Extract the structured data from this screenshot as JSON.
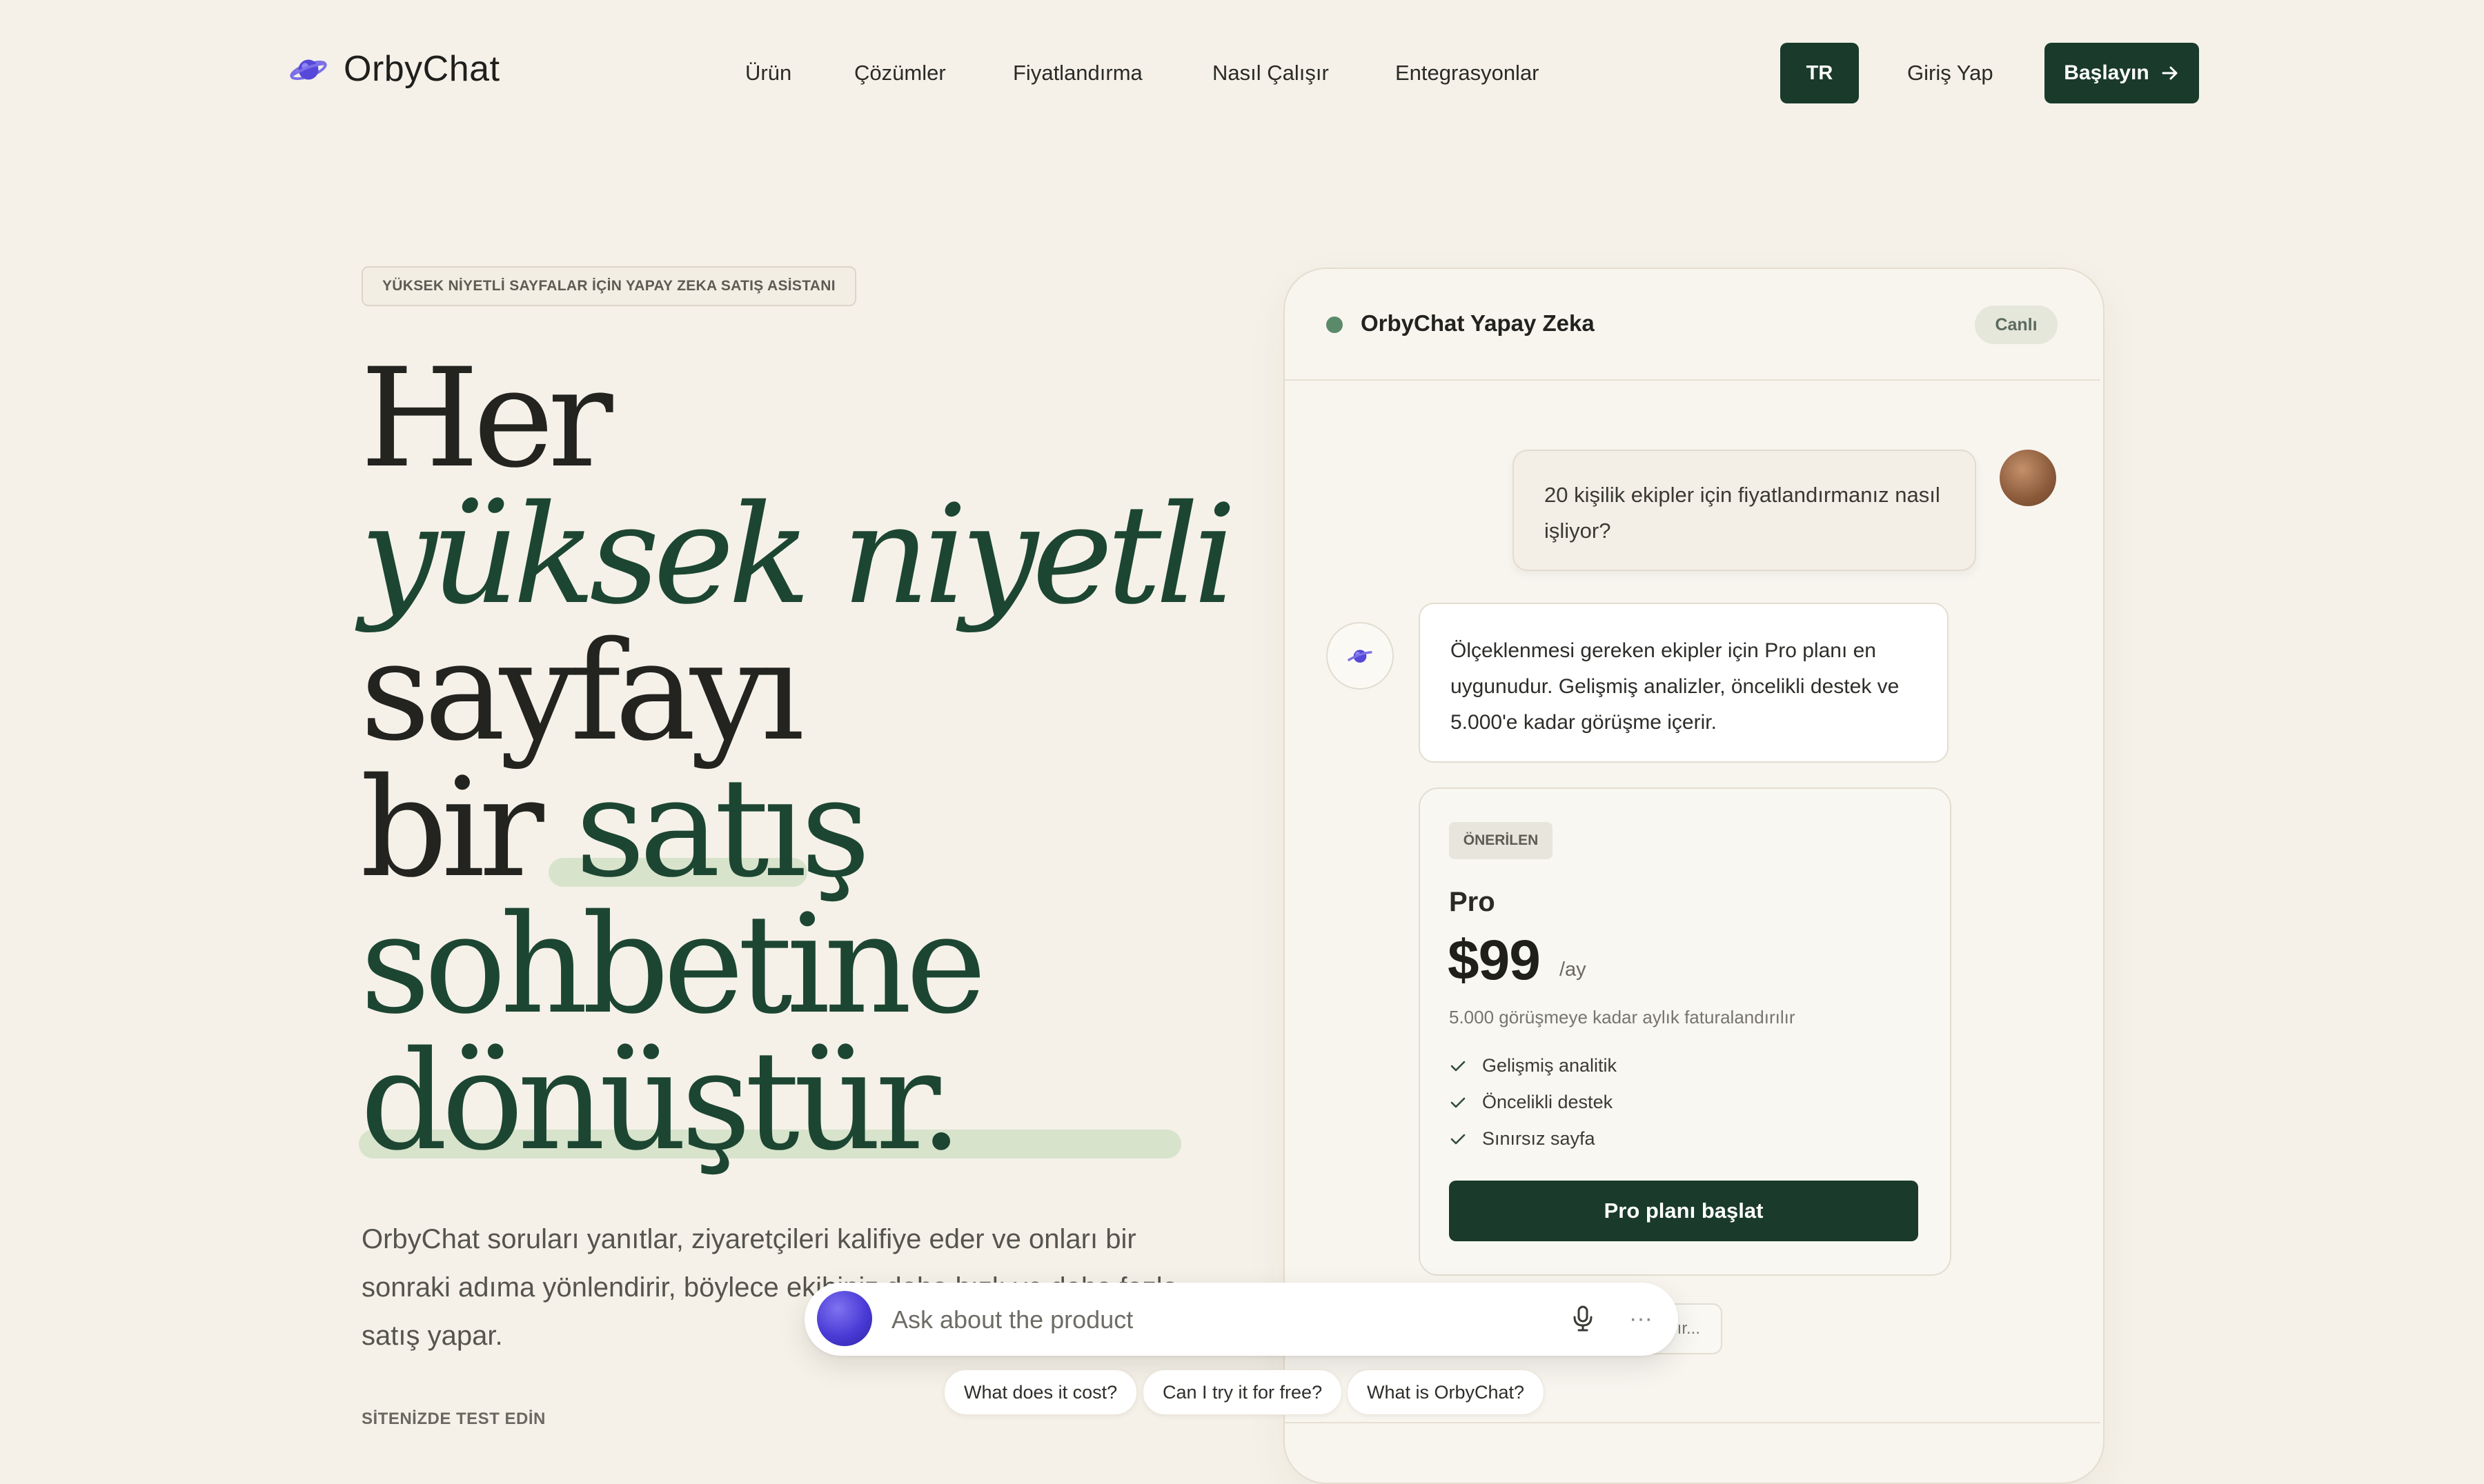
{
  "nav": {
    "brand": "OrbyChat",
    "links": [
      "Ürün",
      "Çözümler",
      "Fiyatlandırma",
      "Nasıl Çalışır",
      "Entegrasyonlar"
    ],
    "lang": "TR",
    "login": "Giriş Yap",
    "cta": "Başlayın"
  },
  "hero": {
    "eyebrow": "YÜKSEK NİYETLİ SAYFALAR İÇİN YAPAY ZEKA SATIŞ ASİSTANI",
    "headline": {
      "line1": "Her",
      "line2": "yüksek niyetli",
      "line3": "sayfayı",
      "line4a": "bir ",
      "line4b": "satış",
      "line5": "sohbetine",
      "line6": "dönüştür."
    },
    "lead": "OrbyChat soruları yanıtlar, ziyaretçileri kalifiye eder ve onları bir sonraki adıma yönlendirir, böylece ekibiniz daha hızlı ve daha fazla satış yapar.",
    "test_label": "SİTENİZDE TEST EDİN"
  },
  "chat": {
    "title": "OrbyChat Yapay Zeka",
    "status": "Canlı",
    "user_message": "20 kişilik ekipler için fiyatlandırmanız nasıl işliyor?",
    "bot_message": "Ölçeklenmesi gereken ekipler için Pro planı en uygunudur. Gelişmiş analizler, öncelikli destek ve 5.000'e kadar görüşme içerir.",
    "plan": {
      "badge": "ÖNERİLEN",
      "name": "Pro",
      "price": "$99",
      "unit": "/ay",
      "note": "5.000 görüşmeye kadar aylık faturalandırılır",
      "features": [
        "Gelişmiş analitik",
        "Öncelikli destek",
        "Sınırsız sayfa"
      ],
      "cta": "Pro planı başlat"
    },
    "partial_chip": "ır..."
  },
  "assistant": {
    "placeholder": "Ask about the product",
    "more": "···",
    "suggestions": [
      "What does it cost?",
      "Can I try it for free?",
      "What is OrbyChat?"
    ]
  },
  "colors": {
    "accent": "#1a3a2b",
    "headline_green": "#1c4632",
    "highlight": "#d8e3cc",
    "background": "#f5f1e8",
    "live_dot": "#5b8a6a"
  },
  "icons": [
    "planet-logo-icon",
    "arrow-right-icon",
    "planet-bot-icon",
    "check-icon",
    "microphone-icon",
    "more-dots-icon",
    "assistant-orb-icon"
  ]
}
